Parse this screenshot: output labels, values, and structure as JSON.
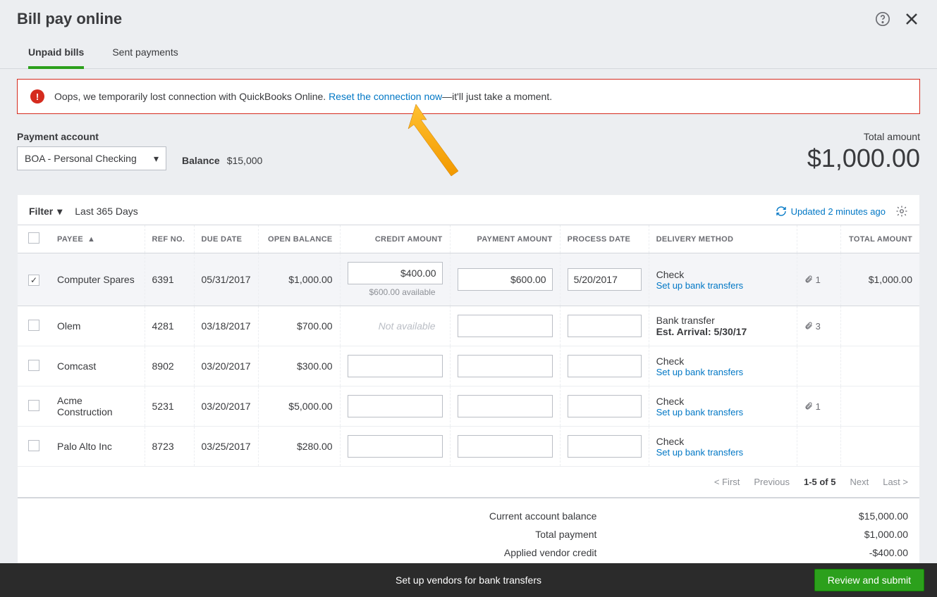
{
  "header": {
    "title": "Bill pay online",
    "tabs": [
      "Unpaid bills",
      "Sent payments"
    ],
    "active_tab": 0
  },
  "alert": {
    "text_before": "Oops, we temporarily lost connection with QuickBooks Online. ",
    "link": "Reset the connection now",
    "text_after": "—it'll just take a moment."
  },
  "account": {
    "label": "Payment account",
    "selected": "BOA - Personal Checking",
    "balance_label": "Balance",
    "balance_value": "$15,000"
  },
  "total": {
    "label": "Total amount",
    "value": "$1,000.00"
  },
  "toolbar": {
    "filter_label": "Filter",
    "filter_value": "Last 365 Days",
    "updated_label": "Updated 2 minutes ago"
  },
  "columns": {
    "payee": "PAYEE",
    "ref": "REF NO.",
    "due": "DUE DATE",
    "open": "OPEN BALANCE",
    "credit": "CREDIT AMOUNT",
    "payment": "PAYMENT AMOUNT",
    "process": "PROCESS DATE",
    "delivery": "DELIVERY METHOD",
    "attach": "",
    "total": "TOTAL AMOUNT"
  },
  "rows": [
    {
      "checked": true,
      "payee": "Computer Spares",
      "ref": "6391",
      "due": "05/31/2017",
      "open": "$1,000.00",
      "credit": "$400.00",
      "credit_note": "$600.00 available",
      "payment": "$600.00",
      "process": "5/20/2017",
      "delivery_primary": "Check",
      "delivery_secondary": "Set up bank transfers",
      "delivery_link": true,
      "attach": "1",
      "total": "$1,000.00"
    },
    {
      "checked": false,
      "payee": "Olem",
      "ref": "4281",
      "due": "03/18/2017",
      "open": "$700.00",
      "credit_na": "Not available",
      "payment": "",
      "process": "",
      "delivery_primary": "Bank transfer",
      "delivery_secondary": "Est. Arrival: 5/30/17",
      "delivery_bold": true,
      "attach": "3",
      "total": ""
    },
    {
      "checked": false,
      "payee": "Comcast",
      "ref": "8902",
      "due": "03/20/2017",
      "open": "$300.00",
      "credit": "",
      "payment": "",
      "process": "",
      "delivery_primary": "Check",
      "delivery_secondary": "Set up bank transfers",
      "delivery_link": true,
      "total": ""
    },
    {
      "checked": false,
      "payee": "Acme Construction",
      "ref": "5231",
      "due": "03/20/2017",
      "open": "$5,000.00",
      "credit": "",
      "payment": "",
      "process": "",
      "delivery_primary": "Check",
      "delivery_secondary": "Set up bank transfers",
      "delivery_link": true,
      "attach": "1",
      "total": ""
    },
    {
      "checked": false,
      "payee": "Palo Alto Inc",
      "ref": "8723",
      "due": "03/25/2017",
      "open": "$280.00",
      "credit": "",
      "payment": "",
      "process": "",
      "delivery_primary": "Check",
      "delivery_secondary": "Set up bank transfers",
      "delivery_link": true,
      "total": ""
    }
  ],
  "pagination": {
    "first": "< First",
    "prev": "Previous",
    "current": "1-5 of 5",
    "next": "Next",
    "last": "Last >"
  },
  "totals_footer": {
    "rows": [
      {
        "label": "Current account balance",
        "value": "$15,000.00"
      },
      {
        "label": "Total payment",
        "value": "$1,000.00"
      },
      {
        "label": "Applied vendor credit",
        "value": "-$400.00"
      }
    ]
  },
  "footer": {
    "link": "Set up vendors for bank transfers",
    "submit": "Review and submit"
  }
}
